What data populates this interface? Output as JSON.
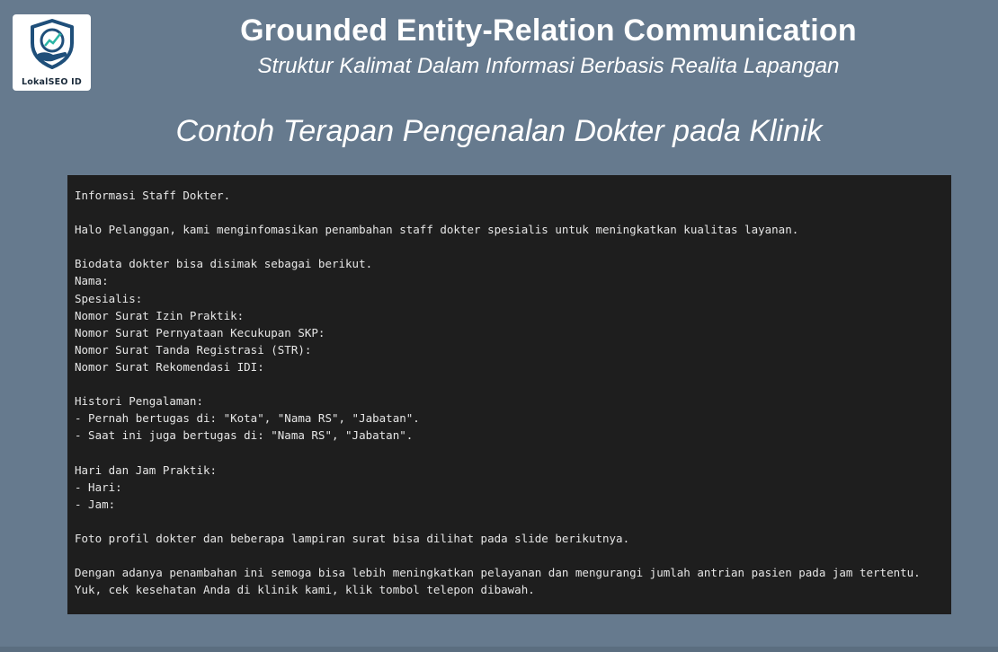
{
  "logo": {
    "text": "LokalSEO ID",
    "icon": "shield-hand-chart-icon"
  },
  "header": {
    "title": "Grounded Entity-Relation Communication",
    "subtitle": "Struktur Kalimat Dalam Informasi Berbasis Realita Lapangan"
  },
  "section": {
    "title": "Contoh Terapan Pengenalan Dokter pada Klinik"
  },
  "content": {
    "lines": [
      "Informasi Staff Dokter.",
      "",
      "Halo Pelanggan, kami menginfomasikan penambahan staff dokter spesialis untuk meningkatkan kualitas layanan.",
      "",
      "Biodata dokter bisa disimak sebagai berikut.",
      "Nama:",
      "Spesialis:",
      "Nomor Surat Izin Praktik:",
      "Nomor Surat Pernyataan Kecukupan SKP:",
      "Nomor Surat Tanda Registrasi (STR):",
      "Nomor Surat Rekomendasi IDI:",
      "",
      "Histori Pengalaman:",
      "- Pernah bertugas di: \"Kota\", \"Nama RS\", \"Jabatan\".",
      "- Saat ini juga bertugas di: \"Nama RS\", \"Jabatan\".",
      "",
      "Hari dan Jam Praktik:",
      "- Hari:",
      "- Jam:",
      "",
      "Foto profil dokter dan beberapa lampiran surat bisa dilihat pada slide berikutnya.",
      "",
      "Dengan adanya penambahan ini semoga bisa lebih meningkatkan pelayanan dan mengurangi jumlah antrian pasien pada jam tertentu.",
      "Yuk, cek kesehatan Anda di klinik kami, klik tombol telepon dibawah."
    ]
  },
  "colors": {
    "background": "#667a8e",
    "code_background": "#1e1e1e",
    "code_text": "#e6e6e6",
    "logo_blue": "#1f4f7a",
    "logo_teal": "#2ab5a5"
  }
}
